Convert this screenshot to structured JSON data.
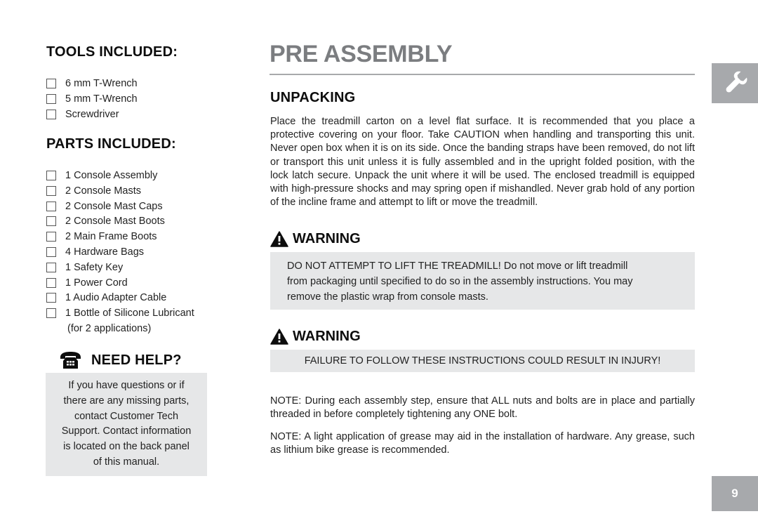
{
  "tools": {
    "heading": "TOOLS INCLUDED:",
    "items": [
      "6 mm T-Wrench",
      "5 mm T-Wrench",
      "Screwdriver"
    ]
  },
  "parts": {
    "heading": "PARTS INCLUDED:",
    "items": [
      "1 Console Assembly",
      "2 Console Masts",
      "2 Console Mast Caps",
      "2 Console Mast Boots",
      "2 Main Frame Boots",
      "4 Hardware Bags",
      "1 Safety Key",
      "1 Power Cord",
      "1 Audio Adapter Cable",
      "1 Bottle of Silicone Lubricant"
    ],
    "last_item_note": "(for 2 applications)"
  },
  "help": {
    "icon": "telephone-icon",
    "heading": "NEED HELP?",
    "lines": [
      "If you have questions or if",
      "there are any missing parts,",
      "contact Customer Tech",
      "Support. Contact information",
      "is located on the back panel",
      "of this manual."
    ]
  },
  "page": {
    "title_bold": "PRE",
    "title_rest": " ASSEMBLY",
    "section_icon": "wrench-icon",
    "page_number": "9"
  },
  "unpacking": {
    "heading": "UNPACKING",
    "body": "Place the treadmill carton on a level flat surface. It is recommended that you place a protective covering on your floor. Take CAUTION when handling and transporting this unit. Never open box when it is on its side. Once the banding straps have been removed, do not lift or transport this unit unless it is fully assembled and in the upright folded position, with the lock latch secure. Unpack the unit where it will be used. The enclosed treadmill is equipped with high-pressure shocks and may spring open if mishandled. Never grab hold of any portion of the incline frame and attempt to lift or move the treadmill."
  },
  "warnings": [
    {
      "icon": "warning-triangle-icon",
      "heading": "WARNING",
      "lines": [
        "DO NOT ATTEMPT TO LIFT THE TREADMILL! Do not move or lift treadmill",
        "from packaging until specified to do so in the assembly instructions. You may",
        "remove the plastic wrap from console masts."
      ]
    },
    {
      "icon": "warning-triangle-icon",
      "heading": "WARNING",
      "lines": [
        "FAILURE TO FOLLOW THESE INSTRUCTIONS COULD RESULT IN INJURY!"
      ]
    }
  ],
  "notes": [
    "NOTE: During each assembly step, ensure that ALL nuts and bolts are in place and partially threaded in before completely tightening any ONE bolt.",
    "NOTE: A light application of grease may aid in the installation of hardware. Any grease, such as lithium bike grease is recommended."
  ]
}
